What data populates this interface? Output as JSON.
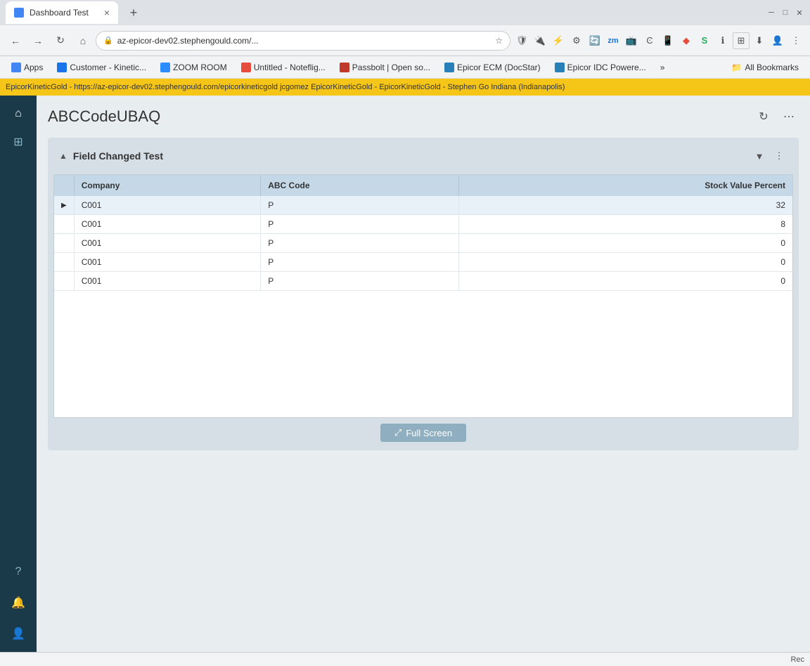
{
  "browser": {
    "tab_title": "Dashboard Test",
    "tab_close": "×",
    "new_tab": "+",
    "address": "az-epicor-dev02.stephengould.com/...",
    "nav_back": "←",
    "nav_forward": "→",
    "nav_refresh": "↻",
    "nav_home": "⌂"
  },
  "bookmarks": [
    {
      "label": "Apps",
      "color": "#4285f4"
    },
    {
      "label": "Customer - Kinetic...",
      "color": "#1a73e8"
    },
    {
      "label": "ZOOM ROOM",
      "color": "#2d8cff"
    },
    {
      "label": "Untitled - Noteflig...",
      "color": "#e74c3c"
    },
    {
      "label": "Passbolt | Open so...",
      "color": "#c0392b"
    },
    {
      "label": "Epicor ECM (DocStar)",
      "color": "#2980b9"
    },
    {
      "label": "Epicor IDC Powere...",
      "color": "#2980b9"
    },
    {
      "label": "»",
      "color": "#555"
    },
    {
      "label": "All Bookmarks",
      "color": "#555"
    }
  ],
  "info_bar": {
    "text": "EpicorKineticGold -   https://az-epicor-dev02.stephengould.com/epicorkineticgold   jcgomez   EpicorKineticGold - EpicorKineticGold - Stephen Go   Indiana (Indianapolis)"
  },
  "sidebar": {
    "icons": [
      "⌂",
      "⊞",
      "?",
      "🔔",
      "👤"
    ]
  },
  "page": {
    "title": "ABCCodeUBAQ",
    "panel_title": "Field Changed Test",
    "table": {
      "columns": [
        "Company",
        "ABC Code",
        "Stock Value Percent"
      ],
      "rows": [
        {
          "indicator": "▶",
          "company": "C001",
          "abc_code": "P",
          "stock_value": "32",
          "selected": true
        },
        {
          "indicator": "",
          "company": "C001",
          "abc_code": "P",
          "stock_value": "8",
          "selected": false
        },
        {
          "indicator": "",
          "company": "C001",
          "abc_code": "P",
          "stock_value": "0",
          "selected": false
        },
        {
          "indicator": "",
          "company": "C001",
          "abc_code": "P",
          "stock_value": "0",
          "selected": false
        },
        {
          "indicator": "",
          "company": "C001",
          "abc_code": "P",
          "stock_value": "0",
          "selected": false
        }
      ]
    },
    "full_screen_label": "Full Screen",
    "full_screen_icon": "⤢"
  },
  "status_bar": {
    "text": "Rec"
  }
}
